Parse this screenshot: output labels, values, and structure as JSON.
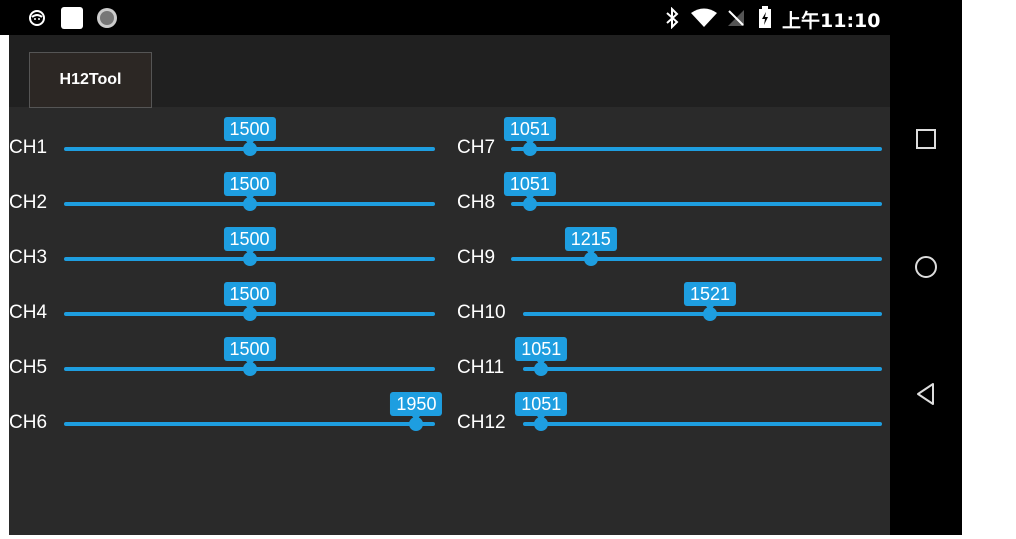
{
  "status_bar": {
    "icons": [
      "face-icon",
      "square-app-icon",
      "circle-app-icon",
      "bluetooth-icon",
      "wifi-icon",
      "no-signal-icon",
      "battery-charging-icon"
    ],
    "clock": "上午11:10"
  },
  "app": {
    "title": "H12Tool",
    "accent_color": "#1e9ee0"
  },
  "slider_range": {
    "min": 1000,
    "max": 2000
  },
  "channels_left": [
    {
      "label": "CH1",
      "value": "1500"
    },
    {
      "label": "CH2",
      "value": "1500"
    },
    {
      "label": "CH3",
      "value": "1500"
    },
    {
      "label": "CH4",
      "value": "1500"
    },
    {
      "label": "CH5",
      "value": "1500"
    },
    {
      "label": "CH6",
      "value": "1950"
    }
  ],
  "channels_right": [
    {
      "label": "CH7",
      "value": "1051"
    },
    {
      "label": "CH8",
      "value": "1051"
    },
    {
      "label": "CH9",
      "value": "1215"
    },
    {
      "label": "CH10",
      "value": "1521"
    },
    {
      "label": "CH11",
      "value": "1051"
    },
    {
      "label": "CH12",
      "value": "1051"
    }
  ],
  "nav_bar": [
    "recents-square-icon",
    "home-circle-icon",
    "back-triangle-icon"
  ]
}
